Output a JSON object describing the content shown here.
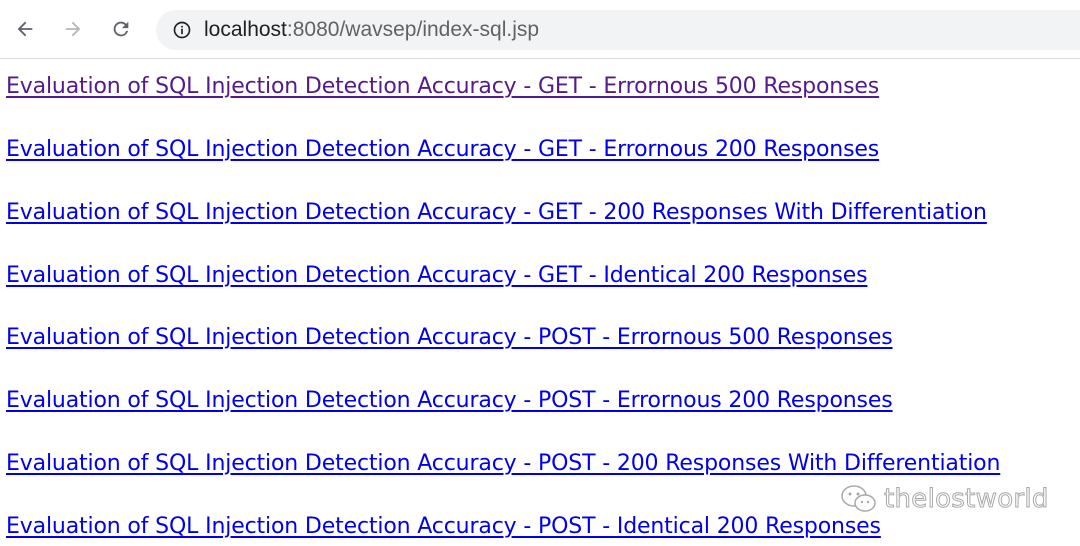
{
  "browser": {
    "url_host": "localhost",
    "url_rest": ":8080/wavsep/index-sql.jsp",
    "back_icon": "arrow-left-icon",
    "forward_icon": "arrow-right-icon",
    "reload_icon": "reload-icon",
    "site_info_icon": "info-circle-icon"
  },
  "links": [
    {
      "label": "Evaluation of SQL Injection Detection Accuracy - GET - Errornous 500 Responses",
      "visited": true
    },
    {
      "label": "Evaluation of SQL Injection Detection Accuracy - GET - Errornous 200 Responses",
      "visited": false
    },
    {
      "label": "Evaluation of SQL Injection Detection Accuracy - GET - 200 Responses With Differentiation",
      "visited": false
    },
    {
      "label": "Evaluation of SQL Injection Detection Accuracy - GET - Identical 200 Responses",
      "visited": false
    },
    {
      "label": "Evaluation of SQL Injection Detection Accuracy - POST - Errornous 500 Responses",
      "visited": false
    },
    {
      "label": "Evaluation of SQL Injection Detection Accuracy - POST - Errornous 200 Responses",
      "visited": false
    },
    {
      "label": "Evaluation of SQL Injection Detection Accuracy - POST - 200 Responses With Differentiation",
      "visited": false
    },
    {
      "label": "Evaluation of SQL Injection Detection Accuracy - POST - Identical 200 Responses",
      "visited": false
    }
  ],
  "watermark": {
    "text": "thelostworld",
    "icon": "wechat-icon"
  },
  "colors": {
    "link": "#0000ee",
    "visited_link": "#551a8b",
    "omnibox_bg": "#f1f3f4"
  }
}
